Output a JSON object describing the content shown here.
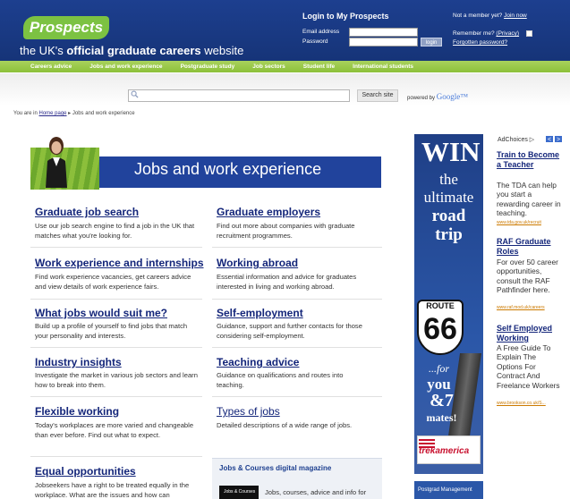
{
  "header": {
    "logo_text": "Prospects",
    "tagline_pre": "the UK's ",
    "tagline_bold": "official graduate careers",
    "tagline_post": " website",
    "login_title": "Login to My Prospects",
    "email_label": "Email address",
    "password_label": "Password",
    "login_button": "login",
    "not_member": "Not a member yet?",
    "join_now": "Join now",
    "remember_me": "Remember me?",
    "privacy": "(Privacy)",
    "forgotten_password": "Forgotten password?"
  },
  "nav": {
    "items": [
      "Careers advice",
      "Jobs and work experience",
      "Postgraduate study",
      "Job sectors",
      "Student life",
      "International students"
    ]
  },
  "search": {
    "placeholder": "",
    "button": "Search site",
    "powered_by": "powered by",
    "google": "Google™"
  },
  "breadcrumb": {
    "prefix": "You are in",
    "home": "Home page",
    "current": "Jobs and work experience"
  },
  "banner": {
    "title": "Jobs and work experience"
  },
  "sections": [
    {
      "title": "Graduate job search",
      "desc": "Use our job search engine to find a job in the UK that matches what you're looking for."
    },
    {
      "title": "Graduate employers",
      "desc": "Find out more about companies with graduate recruitment programmes."
    },
    {
      "title": "Work experience and internships",
      "desc": "Find work experience vacancies, get careers advice and view details of work experience fairs."
    },
    {
      "title": "Working abroad",
      "desc": "Essential information and advice for graduates interested in living and working abroad."
    },
    {
      "title": "What jobs would suit me?",
      "desc": "Build up a profile of yourself to find jobs that match your personality and interests."
    },
    {
      "title": "Self-employment",
      "desc": "Guidance, support and further contacts for those considering self-employment."
    },
    {
      "title": "Industry insights",
      "desc": "Investigate the market in various job sectors and learn how to break into them."
    },
    {
      "title": "Teaching advice",
      "desc": "Guidance on qualifications and routes into teaching."
    },
    {
      "title": "Flexible working",
      "desc": "Today's workplaces are more varied and changeable than ever before. Find out what to expect."
    },
    {
      "title": "Types of jobs",
      "desc": "Detailed descriptions of a wide range of jobs."
    },
    {
      "title": "Equal opportunities",
      "desc": "Jobseekers have a right to be treated equally in the workplace. What are the issues and how can"
    }
  ],
  "magazine": {
    "title": "Jobs & Courses digital magazine",
    "thumb": "Jobs & Courses",
    "desc": "Jobs, courses, advice and info for"
  },
  "sky_ad": {
    "win": "WIN",
    "the": "the",
    "ultimate": "ultimate",
    "road": "road",
    "trip": "trip",
    "route": "ROUTE",
    "num": "66",
    "for": "...for",
    "you": "you",
    "amp7": "&7",
    "mates": "mates!",
    "brand": "trekamerica",
    "second": "Postgrad Management"
  },
  "text_ads": {
    "adchoices": "AdChoices",
    "prev": "<",
    "next": ">",
    "ads": [
      {
        "title": "Train to Become a Teacher",
        "body": "The TDA can help you start a rewarding career in teaching.",
        "url": "www.tda.gov.uk/recruit"
      },
      {
        "title": "RAF Graduate Roles",
        "body": "For over 50 career opportunities, consult the RAF Pathfinder here.",
        "url": "www.raf.mod.uk/careers"
      },
      {
        "title": "Self Employed Working",
        "body": "A Free Guide To Explain The Options For Contract And Freelance Workers",
        "url": "www.brookson.co.uk/S..."
      }
    ]
  }
}
